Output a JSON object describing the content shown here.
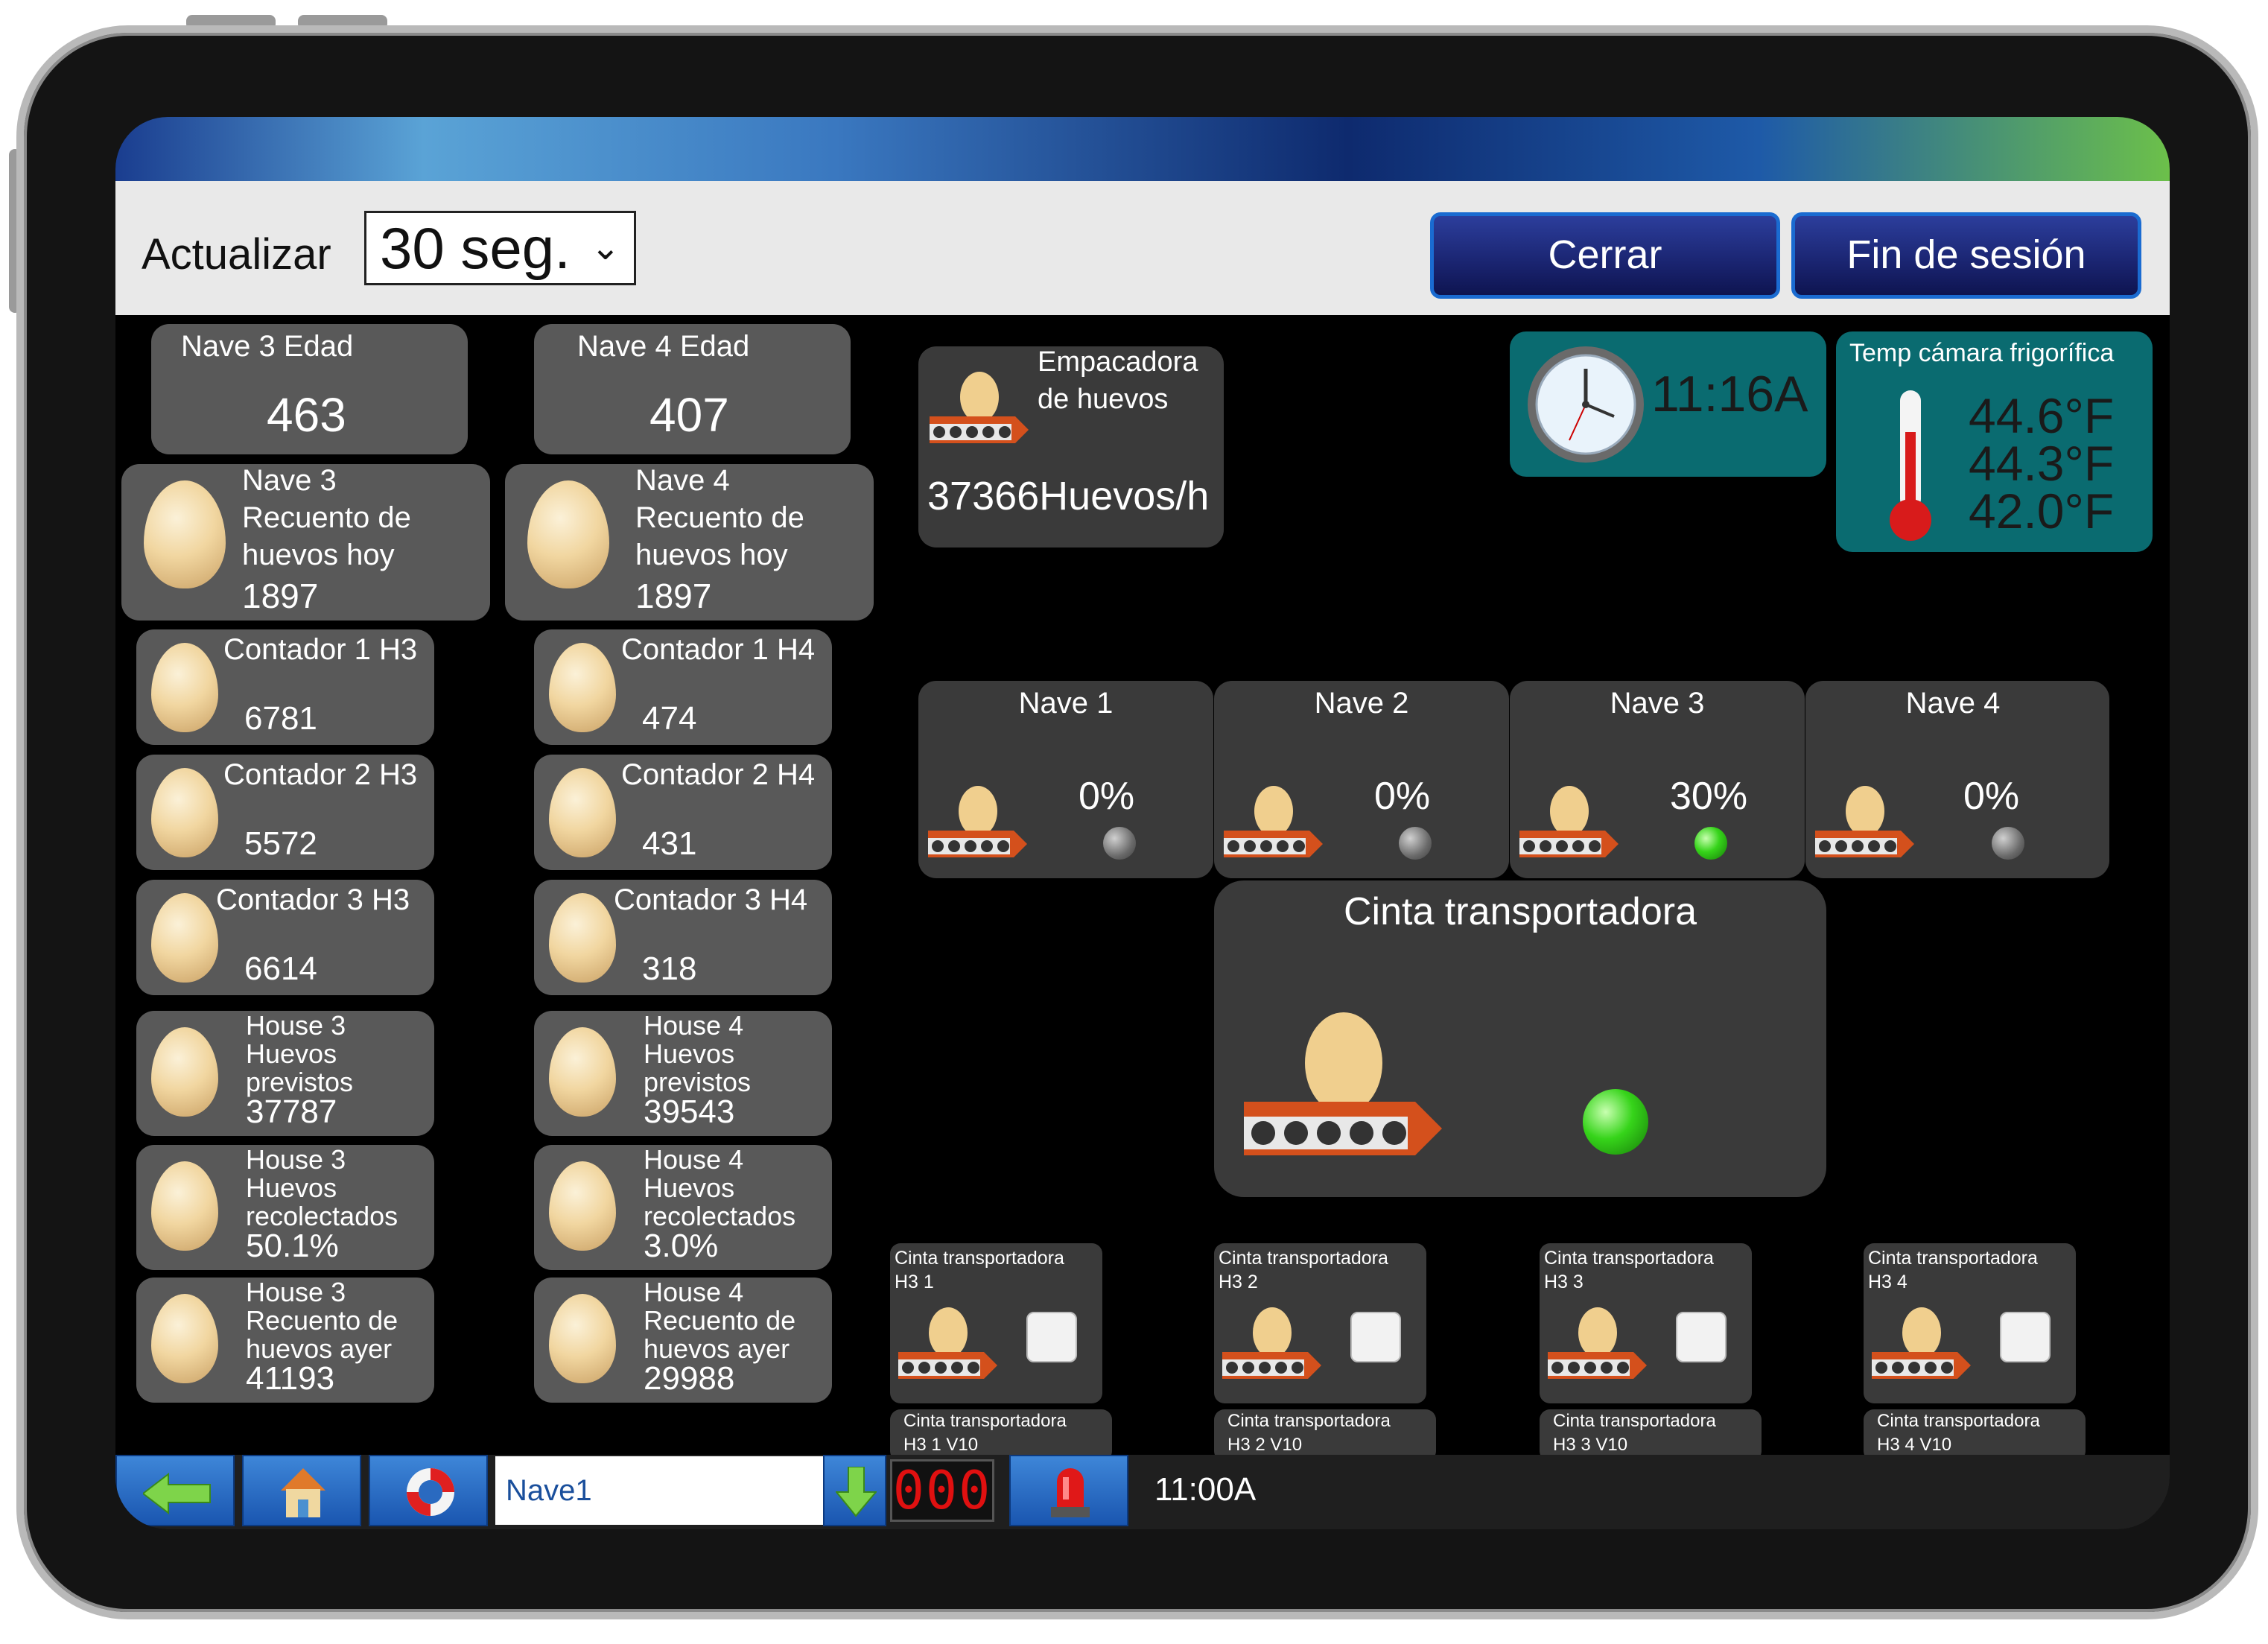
{
  "toolbar": {
    "refresh_label": "Actualizar",
    "refresh_value": "30 seg.",
    "close_label": "Cerrar",
    "logout_label": "Fin de sesión"
  },
  "age_cards": [
    {
      "title": "Nave 3 Edad",
      "value": "463"
    },
    {
      "title": "Nave 4 Edad",
      "value": "407"
    }
  ],
  "today_counts": [
    {
      "line1": "Nave 3",
      "line2": "Recuento de",
      "line3": "huevos hoy",
      "value": "1897"
    },
    {
      "line1": "Nave 4",
      "line2": "Recuento de",
      "line3": "huevos hoy",
      "value": "1897"
    }
  ],
  "counters_h3": [
    {
      "label": "Contador 1 H3",
      "value": "6781"
    },
    {
      "label": "Contador 2 H3",
      "value": "5572"
    },
    {
      "label": "Contador 3 H3",
      "value": "6614"
    }
  ],
  "counters_h4": [
    {
      "label": "Contador 1 H4",
      "value": "474"
    },
    {
      "label": "Contador 2 H4",
      "value": "431"
    },
    {
      "label": "Contador 3 H4",
      "value": "318"
    }
  ],
  "stats_h3": [
    {
      "l1": "House 3",
      "l2": "Huevos",
      "l3": "previstos",
      "value": "37787"
    },
    {
      "l1": "House 3",
      "l2": "Huevos",
      "l3": "recolectados",
      "value": "50.1%"
    },
    {
      "l1": "House 3",
      "l2": "Recuento de",
      "l3": "huevos ayer",
      "value": "41193"
    }
  ],
  "stats_h4": [
    {
      "l1": "House 4",
      "l2": "Huevos",
      "l3": "previstos",
      "value": "39543"
    },
    {
      "l1": "House 4",
      "l2": "Huevos",
      "l3": "recolectados",
      "value": "3.0%"
    },
    {
      "l1": "House 4",
      "l2": "Recuento de",
      "l3": "huevos ayer",
      "value": "29988"
    }
  ],
  "packer": {
    "line1": "Empacadora",
    "line2": "de huevos",
    "rate": "37366Huevos/h"
  },
  "clock": {
    "time": "11:16A"
  },
  "cold_room": {
    "title": "Temp cámara  frigorífica",
    "temps": [
      "44.6°F",
      "44.3°F",
      "42.0°F"
    ]
  },
  "naves": [
    {
      "name": "Nave 1",
      "percent": "0%",
      "status": "off"
    },
    {
      "name": "Nave 2",
      "percent": "0%",
      "status": "off"
    },
    {
      "name": "Nave 3",
      "percent": "30%",
      "status": "on"
    },
    {
      "name": "Nave 4",
      "percent": "0%",
      "status": "off"
    }
  ],
  "conveyor": {
    "title": "Cinta transportadora",
    "status": "on"
  },
  "belts": [
    {
      "l1": "Cinta transportadora",
      "l2": "H3 1",
      "sub1": "Cinta transportadora",
      "sub2": "H3 1 V10"
    },
    {
      "l1": "Cinta transportadora",
      "l2": "H3 2",
      "sub1": "Cinta transportadora",
      "sub2": "H3 2 V10"
    },
    {
      "l1": "Cinta transportadora",
      "l2": "H3 3",
      "sub1": "Cinta transportadora",
      "sub2": "H3 3 V10"
    },
    {
      "l1": "Cinta transportadora",
      "l2": "H3 4",
      "sub1": "Cinta transportadora",
      "sub2": "H3 4 V10"
    }
  ],
  "bottom_bar": {
    "field_value": "Nave1",
    "alarm_count": "000",
    "time": "11:00A"
  },
  "colors": {
    "card_gray": "#595959",
    "panel_dark": "#3a3a3a",
    "teal": "#0a6b70",
    "led_green": "#36d41a",
    "belt_orange": "#d4501c"
  }
}
